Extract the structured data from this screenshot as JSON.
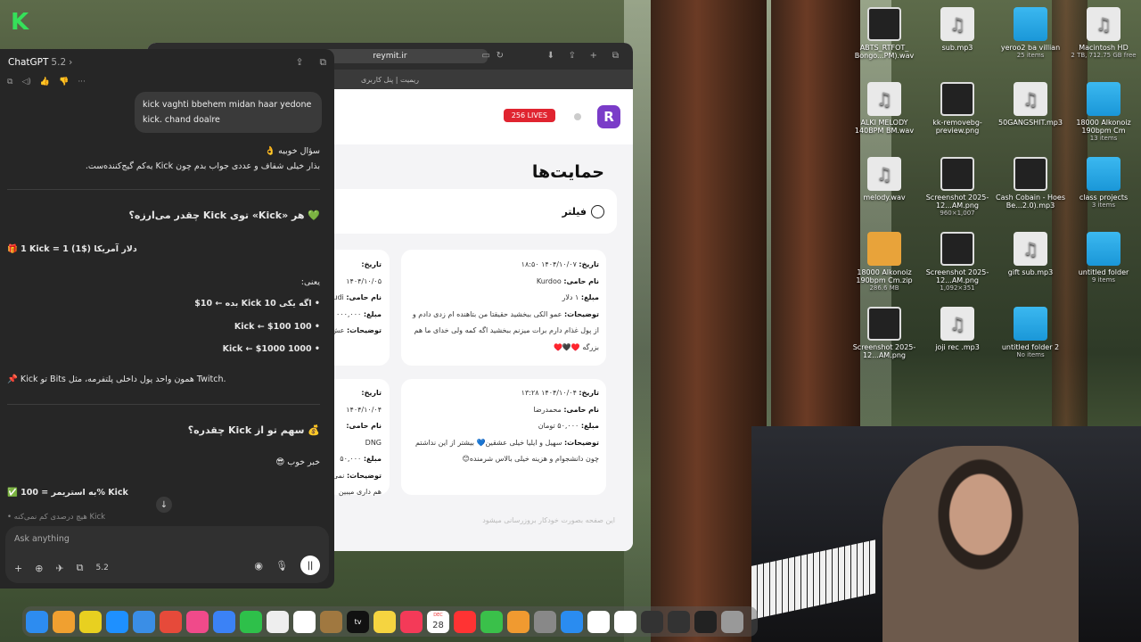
{
  "desktop": {
    "icons": [
      {
        "label": "ABTS_RTFOT_ Bongo...PM).wav",
        "sub": "",
        "kind": "thumb"
      },
      {
        "label": "sub.mp3",
        "sub": "",
        "kind": "file"
      },
      {
        "label": "yeroo2 ba villian",
        "sub": "25 items",
        "kind": "folder"
      },
      {
        "label": "Macintosh HD",
        "sub": "2 TB, 712.75 GB free",
        "kind": "drive"
      },
      {
        "label": "ALKI MELODY 140BPM BM.wav",
        "sub": "",
        "kind": "file"
      },
      {
        "label": "kk-removebg-preview.png",
        "sub": "",
        "kind": "thumb"
      },
      {
        "label": "50GANGSHIT.mp3",
        "sub": "",
        "kind": "file"
      },
      {
        "label": "18000 Alkonoiz 190bpm Cm",
        "sub": "13 items",
        "kind": "folder"
      },
      {
        "label": "melody.wav",
        "sub": "",
        "kind": "file"
      },
      {
        "label": "Screenshot 2025-12...AM.png",
        "sub": "960×1,007",
        "kind": "shot"
      },
      {
        "label": "Cash Cobain - Hoes Be...2.0).mp3",
        "sub": "",
        "kind": "thumb"
      },
      {
        "label": "class projects",
        "sub": "3 items",
        "kind": "folder"
      },
      {
        "label": "18000 Alkonoiz 190bpm Cm.zip",
        "sub": "286.6 MB",
        "kind": "zip"
      },
      {
        "label": "Screenshot 2025-12...AM.png",
        "sub": "1,092×351",
        "kind": "shot"
      },
      {
        "label": "gift sub.mp3",
        "sub": "",
        "kind": "file"
      },
      {
        "label": "untitled folder",
        "sub": "9 items",
        "kind": "folder"
      },
      {
        "label": "Screenshot 2025-12...AM.png",
        "sub": "",
        "kind": "shot"
      },
      {
        "label": "joji rec .mp3",
        "sub": "",
        "kind": "file"
      },
      {
        "label": "untitled folder 2",
        "sub": "No items",
        "kind": "folder"
      }
    ]
  },
  "chat": {
    "app_title": "ChatGPT",
    "version": "5.2",
    "user_message": "kick vaghti bbehem midan haar yedone kick. chand doalre",
    "lines": [
      "سؤال خوبیه 👌",
      "بذار خیلی شفاف و عددی جواب بدم چون Kick یه‌کم گیج‌کننده‌ست.",
      "💚 هر «Kick» توی Kick چقدر می‌ارزه؟",
      "🎁 1 Kick = 1 (1$) دلار آمریکا",
      "یعنی:",
      "• اگه یکی 10 Kick بده ← 10$",
      "• Kick ← $100 100",
      "• Kick ← $1000 1000",
      "📌 Kick تو Bits همون واحد پول داخلی پلتفرمه، مثل Twitch.",
      "💰 سهم تو از Kick چقدره؟",
      "خبر خوب 😎",
      "✅ به استریمر = 100% Kick",
      "• هیچ درصدی کم نمی‌کنه Kick"
    ],
    "input_placeholder": "Ask anything",
    "model_label": "5.2"
  },
  "browser": {
    "url": "reymit.ir",
    "tab_title": "ریمیت | پنل کاربری",
    "lives_badge": "256 LIVES",
    "logo_letter": "R",
    "page_title": "حمایت‌ها",
    "filter_label": "فیلتر",
    "footer_note": "این صفحه بصورت خودکار بروزرسانی میشود",
    "donations": [
      {
        "date_label": "تاریخ:",
        "date": "۱۴۰۴/۱۰/۰۷  ۱۸:۵۰",
        "name_label": "نام حامی:",
        "name": "Kurdoo",
        "amount_label": "مبلغ:",
        "amount": "۱ دلار",
        "desc_label": "توضیحات:",
        "desc": "عمو الکی ببخشید حقیقتا من بتاهنده ام زدی دادم و از پول غذام دارم برات میزنم ببخشید اگه کمه ولی خدای ما هم بزرگه ♥️🖤♥️"
      },
      {
        "date_label": "تاریخ:",
        "date": "۱۴۰۴/۱۰/۰۴  ۱۳:۲۸",
        "name_label": "نام حامی:",
        "name": "محمدرضا",
        "amount_label": "مبلغ:",
        "amount": "۵۰,۰۰۰ تومان",
        "desc_label": "توضیحات:",
        "desc": "سهیل و ایلیا خیلی عشقین💙 بیشتر از این نداشتم چون دانشجوام و هزینه خیلی بالاس شرمنده😊"
      },
      {
        "date_label": "تاریخ:",
        "date": "۱۴۰۴/۱۰/۰۵",
        "name_label": "نام حامی:",
        "name": "udi",
        "amount_label": "مبلغ:",
        "amount": "۰۰۰,۰۰۰",
        "desc_label": "توضیحات:",
        "desc": "عش"
      },
      {
        "date_label": "تاریخ:",
        "date": "۱۴۰۴/۱۰/۰۴",
        "name_label": "نام حامی:",
        "name": "DNG",
        "amount_label": "مبلغ:",
        "amount": "۵۰,۰۰۰",
        "desc_label": "توضیحات:",
        "desc": "نمی هم داری میبین"
      }
    ]
  },
  "dock": {
    "calendar_month": "DEC",
    "calendar_day": "28",
    "appletv_label": "tv"
  }
}
